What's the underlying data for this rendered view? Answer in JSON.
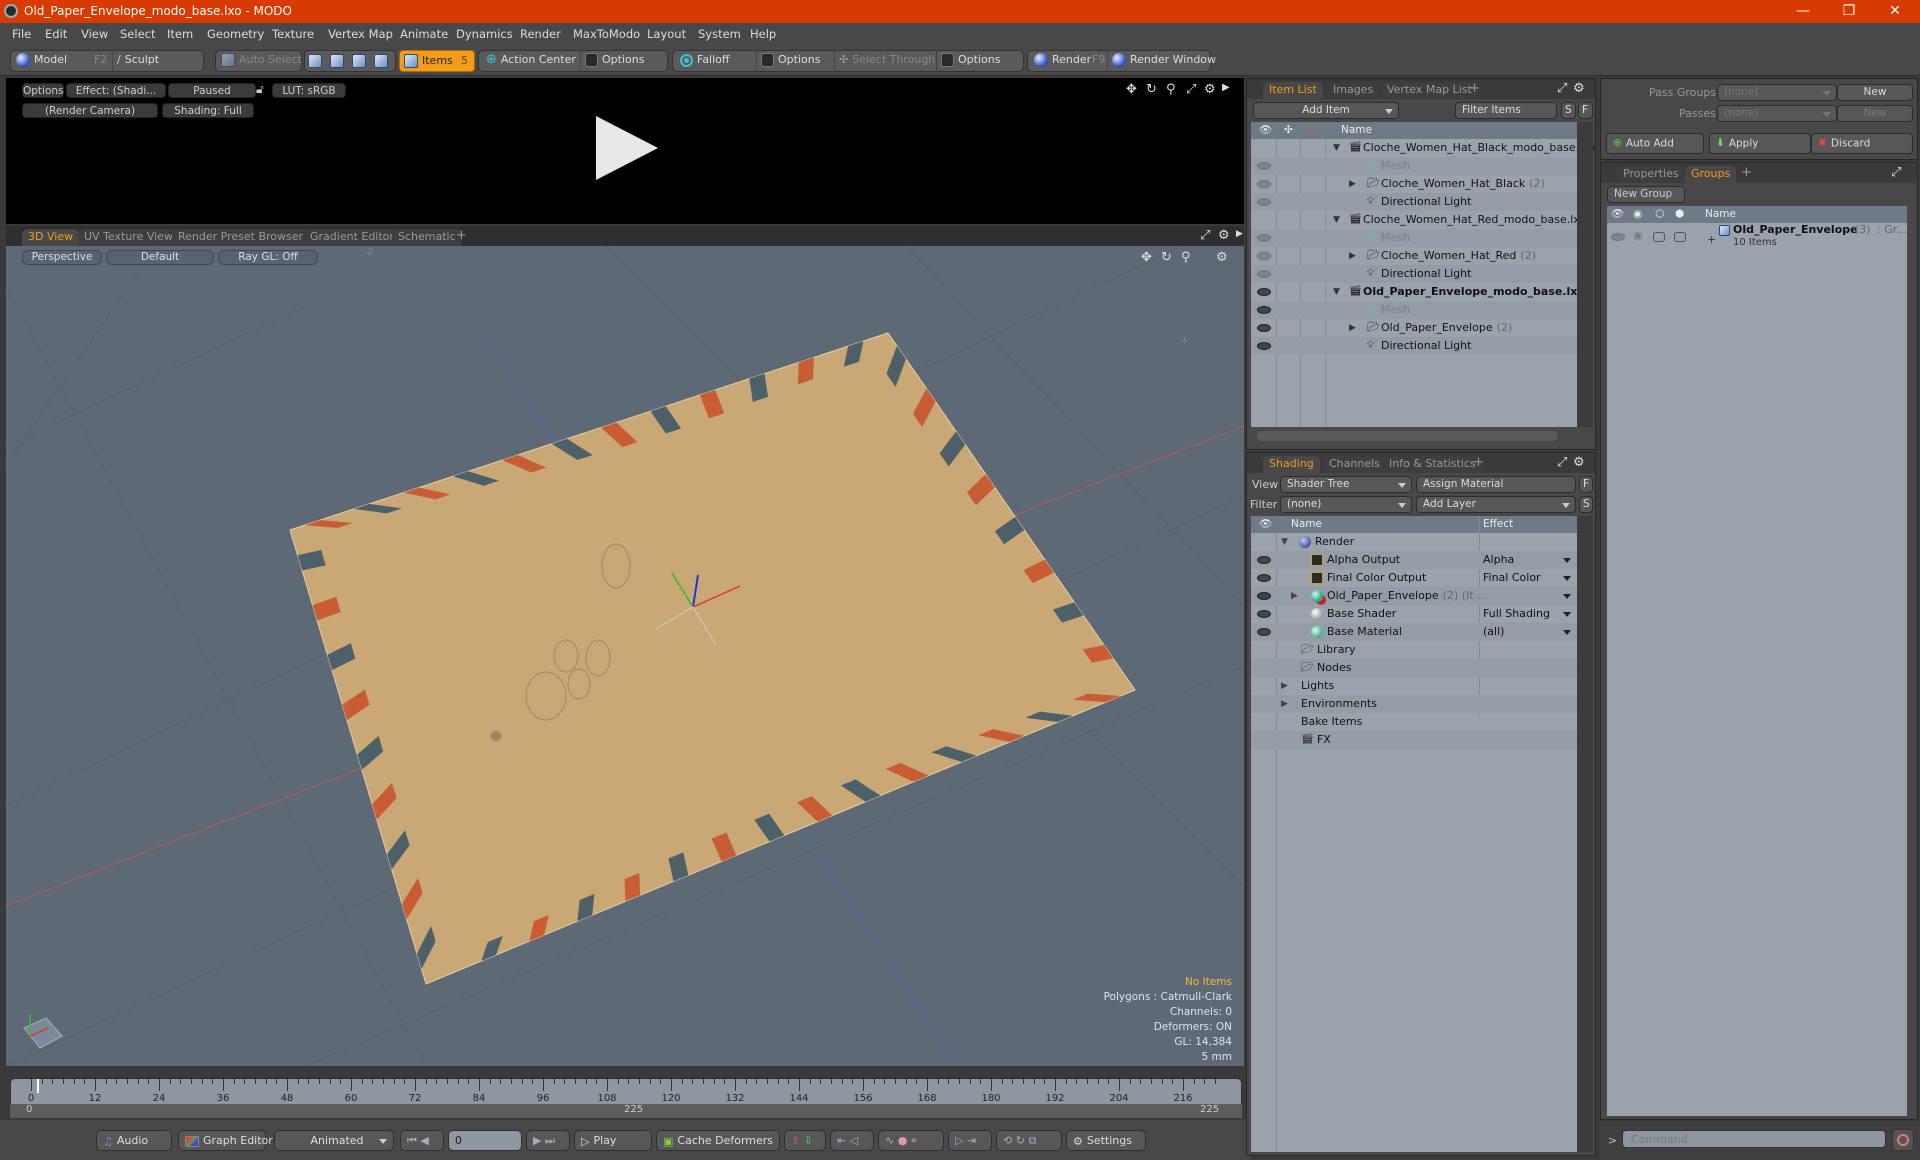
{
  "window": {
    "title": "Old_Paper_Envelope_modo_base.lxo - MODO",
    "controls": {
      "minimize": "—",
      "restore": "❐",
      "close": "✕"
    }
  },
  "menu": [
    "File",
    "Edit",
    "View",
    "Select",
    "Item",
    "Geometry",
    "Texture",
    "Vertex Map",
    "Animate",
    "Dynamics",
    "Render",
    "MaxToModo",
    "Layout",
    "System",
    "Help"
  ],
  "toolbar": {
    "model": "Model",
    "model_key": "F2",
    "sculpt": "Sculpt",
    "auto_select": "Auto Select",
    "items": "Items",
    "items_count": "5",
    "action_center": "Action Center",
    "options1": "Options",
    "falloff": "Falloff",
    "options2": "Options",
    "select_through": "Select Through",
    "options3": "Options",
    "render": "Render",
    "render_key": "F9",
    "render_window": "Render Window"
  },
  "render_preview": {
    "options": "Options",
    "effect": "Effect: (Shadi...",
    "status": "Paused",
    "lut": "LUT: sRGB",
    "camera": "(Render Camera)",
    "shading": "Shading: Full"
  },
  "viewport_tabs": [
    "3D View",
    "UV Texture View",
    "Render Preset Browser",
    "Gradient Editor",
    "Schematic",
    "+"
  ],
  "viewport": {
    "projection": "Perspective",
    "style": "Default",
    "raygl": "Ray GL: Off",
    "axis_label": "-Z",
    "info": {
      "selection": "No Items",
      "polygons": "Polygons : Catmull-Clark",
      "channels": "Channels: 0",
      "deformers": "Deformers: ON",
      "gl": "GL: 14,384",
      "units": "5 mm"
    },
    "colors": {
      "background": "#5d6a76",
      "paper": "#c9a876",
      "stripe_red": "#c8542c",
      "stripe_blue": "#3f5866"
    }
  },
  "timeline": {
    "ticks": [
      "0",
      "12",
      "24",
      "36",
      "48",
      "60",
      "72",
      "84",
      "96",
      "108",
      "120",
      "132",
      "144",
      "156",
      "168",
      "180",
      "192",
      "204",
      "216"
    ],
    "range_start": "0",
    "range_mid": "225",
    "range_end": "225",
    "current_frame": 0
  },
  "bottombar": {
    "audio": "Audio",
    "graph_editor": "Graph Editor",
    "animated": "Animated",
    "frame": "0",
    "play": "Play",
    "cache_deformers": "Cache Deformers",
    "settings": "Settings"
  },
  "item_list": {
    "tabs": [
      "Item List",
      "Images",
      "Vertex Map List",
      "+"
    ],
    "add_item": "Add Item",
    "filter": "Filter Items",
    "s": "S",
    "f": "F",
    "col_name": "Name",
    "rows": [
      {
        "label": "Cloche_Women_Hat_Black_modo_base.lxo",
        "count": "",
        "type": "scene",
        "level": 0,
        "bold": false,
        "dim": false,
        "eye": "none"
      },
      {
        "label": "Mesh",
        "count": "",
        "type": "mesh",
        "level": 1,
        "bold": false,
        "dim": true,
        "eye": "faint"
      },
      {
        "label": "Cloche_Women_Hat_Black",
        "count": "(2)",
        "type": "group",
        "level": 1,
        "bold": false,
        "dim": false,
        "eye": "faint"
      },
      {
        "label": "Directional Light",
        "count": "",
        "type": "light",
        "level": 1,
        "bold": false,
        "dim": false,
        "eye": "faint"
      },
      {
        "label": "Cloche_Women_Hat_Red_modo_base.lxo",
        "count": "",
        "type": "scene",
        "level": 0,
        "bold": false,
        "dim": false,
        "eye": "none"
      },
      {
        "label": "Mesh",
        "count": "",
        "type": "mesh",
        "level": 1,
        "bold": false,
        "dim": true,
        "eye": "faint"
      },
      {
        "label": "Cloche_Women_Hat_Red",
        "count": "(2)",
        "type": "group",
        "level": 1,
        "bold": false,
        "dim": false,
        "eye": "faint"
      },
      {
        "label": "Directional Light",
        "count": "",
        "type": "light",
        "level": 1,
        "bold": false,
        "dim": false,
        "eye": "faint"
      },
      {
        "label": "Old_Paper_Envelope_modo_base.lxo",
        "count": "",
        "type": "scene",
        "level": 0,
        "bold": true,
        "dim": false,
        "eye": "on"
      },
      {
        "label": "Mesh",
        "count": "",
        "type": "mesh",
        "level": 1,
        "bold": false,
        "dim": true,
        "eye": "on"
      },
      {
        "label": "Old_Paper_Envelope",
        "count": "(2)",
        "type": "group",
        "level": 1,
        "bold": false,
        "dim": false,
        "eye": "on"
      },
      {
        "label": "Directional Light",
        "count": "",
        "type": "light",
        "level": 1,
        "bold": false,
        "dim": false,
        "eye": "on"
      }
    ]
  },
  "shading": {
    "tabs": [
      "Shading",
      "Channels",
      "Info & Statistics",
      "+"
    ],
    "view_label": "View",
    "view_value": "Shader Tree",
    "assign_material": "Assign Material",
    "filter_label": "Filter",
    "filter_value": "(none)",
    "add_layer": "Add Layer",
    "f": "F",
    "s": "S",
    "col_name": "Name",
    "col_effect": "Effect",
    "rows": [
      {
        "label": "Render",
        "extra": "",
        "effect": "",
        "icon": "render",
        "level": 0,
        "eye": false,
        "expander": "open",
        "dropdown": false
      },
      {
        "label": "Alpha Output",
        "extra": "",
        "effect": "Alpha",
        "icon": "output",
        "level": 1,
        "eye": true,
        "expander": "",
        "dropdown": true
      },
      {
        "label": "Final Color Output",
        "extra": "",
        "effect": "Final Color",
        "icon": "output",
        "level": 1,
        "eye": true,
        "expander": "",
        "dropdown": true
      },
      {
        "label": "Old_Paper_Envelope",
        "extra": "(2) (It ...",
        "effect": "",
        "icon": "material-group",
        "level": 1,
        "eye": true,
        "expander": "closed",
        "dropdown": true
      },
      {
        "label": "Base Shader",
        "extra": "",
        "effect": "Full Shading",
        "icon": "shader",
        "level": 1,
        "eye": true,
        "expander": "",
        "dropdown": true
      },
      {
        "label": "Base Material",
        "extra": "",
        "effect": "(all)",
        "icon": "material",
        "level": 1,
        "eye": true,
        "expander": "",
        "dropdown": true
      },
      {
        "label": "Library",
        "extra": "",
        "effect": "",
        "icon": "folder",
        "level": 0.5,
        "eye": false,
        "expander": "",
        "dropdown": false
      },
      {
        "label": "Nodes",
        "extra": "",
        "effect": "",
        "icon": "folder",
        "level": 0.5,
        "eye": false,
        "expander": "",
        "dropdown": false
      },
      {
        "label": "Lights",
        "extra": "",
        "effect": "",
        "icon": "",
        "level": 0,
        "eye": false,
        "expander": "closed",
        "dropdown": false
      },
      {
        "label": "Environments",
        "extra": "",
        "effect": "",
        "icon": "",
        "level": 0,
        "eye": false,
        "expander": "closed",
        "dropdown": false
      },
      {
        "label": "Bake Items",
        "extra": "",
        "effect": "",
        "icon": "",
        "level": 0,
        "eye": false,
        "expander": "",
        "dropdown": false
      },
      {
        "label": "FX",
        "extra": "",
        "effect": "",
        "icon": "fx",
        "level": 0.5,
        "eye": false,
        "expander": "",
        "dropdown": false
      }
    ]
  },
  "passes": {
    "pass_groups_label": "Pass Groups",
    "pass_groups_value": "(none)",
    "passes_label": "Passes",
    "passes_value": "(none)",
    "new1": "New",
    "new2": "New",
    "auto_add": "Auto Add",
    "apply": "Apply",
    "discard": "Discard"
  },
  "groups": {
    "tabs": [
      "Properties",
      "Groups",
      "+"
    ],
    "new_group": "New Group",
    "col_name": "Name",
    "rows": [
      {
        "label": "Old_Paper_Envelope",
        "count": "(3)",
        "suffix": ": Gr...",
        "sub": "10 Items"
      }
    ]
  },
  "command": {
    "prompt": ">",
    "placeholder": "Command"
  }
}
